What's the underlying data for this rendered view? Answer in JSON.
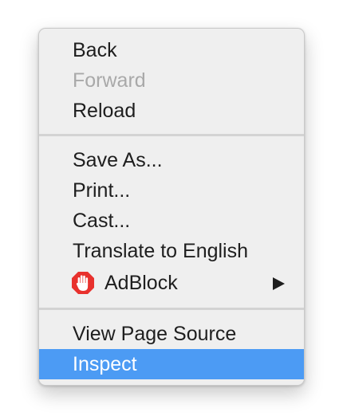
{
  "context_menu": {
    "items": [
      {
        "label": "Back",
        "enabled": true
      },
      {
        "label": "Forward",
        "enabled": false
      },
      {
        "label": "Reload",
        "enabled": true
      },
      {
        "label": "Save As...",
        "enabled": true
      },
      {
        "label": "Print...",
        "enabled": true
      },
      {
        "label": "Cast...",
        "enabled": true
      },
      {
        "label": "Translate to English",
        "enabled": true
      },
      {
        "label": "AdBlock",
        "enabled": true,
        "icon": "adblock-hand-icon",
        "has_submenu": true
      },
      {
        "label": "View Page Source",
        "enabled": true
      },
      {
        "label": "Inspect",
        "enabled": true,
        "highlighted": true
      }
    ]
  },
  "colors": {
    "menu_background": "#efefef",
    "highlight": "#4c9bf4",
    "text": "#1e1e1e",
    "disabled_text": "#a9a9a9",
    "separator": "#d3d3d3",
    "adblock_red": "#e8312d"
  }
}
